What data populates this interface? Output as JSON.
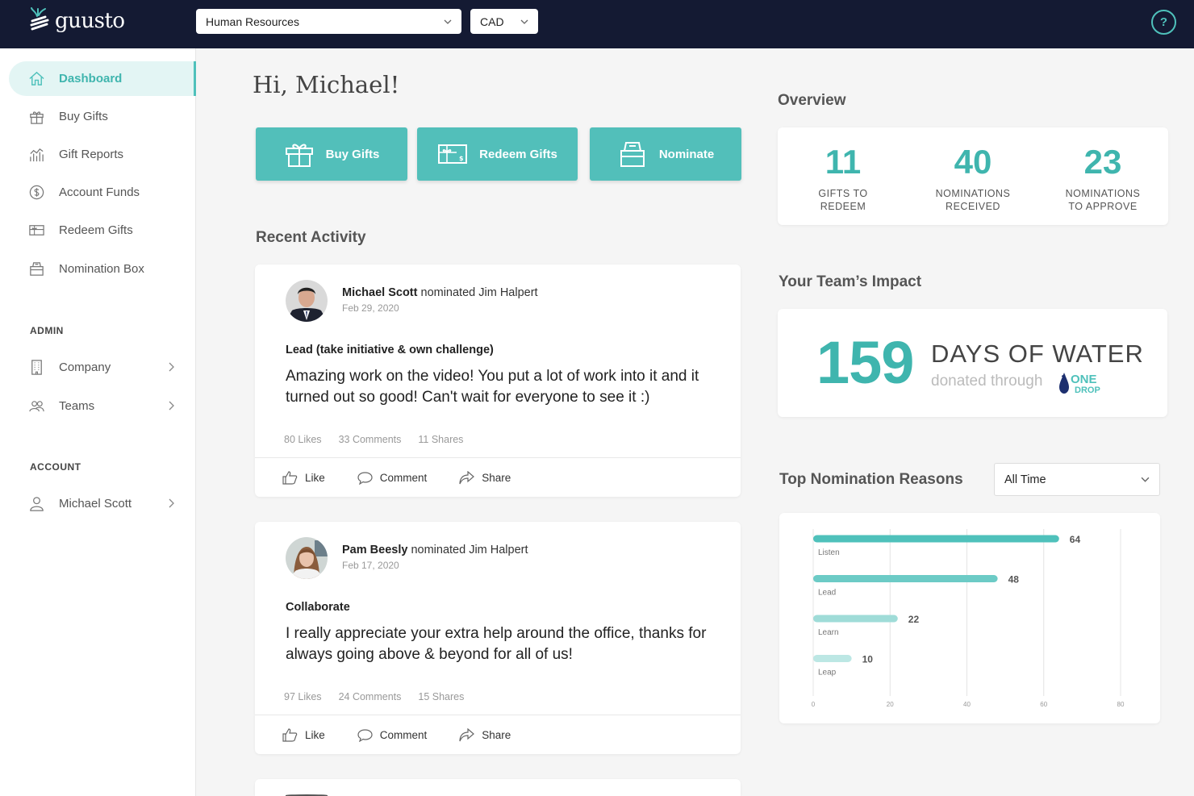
{
  "brand": {
    "name": "guusto",
    "accent": "#52bfba",
    "topbar": "#141a33"
  },
  "header": {
    "department": "Human Resources",
    "currency": "CAD",
    "help": "?"
  },
  "sidebar": {
    "items": [
      {
        "label": "Dashboard",
        "icon": "home-icon"
      },
      {
        "label": "Buy Gifts",
        "icon": "gift-icon"
      },
      {
        "label": "Gift Reports",
        "icon": "chart-icon"
      },
      {
        "label": "Account Funds",
        "icon": "dollar-icon"
      },
      {
        "label": "Redeem Gifts",
        "icon": "giftcard-icon"
      },
      {
        "label": "Nomination Box",
        "icon": "box-icon"
      }
    ],
    "admin_label": "ADMIN",
    "admin_items": [
      {
        "label": "Company",
        "icon": "building-icon"
      },
      {
        "label": "Teams",
        "icon": "people-icon"
      }
    ],
    "account_label": "ACCOUNT",
    "account_items": [
      {
        "label": "Michael Scott",
        "icon": "user-icon"
      }
    ]
  },
  "main": {
    "greeting": "Hi, Michael!",
    "actions": [
      {
        "label": "Buy Gifts",
        "icon": "gift-icon"
      },
      {
        "label": "Redeem Gifts",
        "icon": "giftcard-icon"
      },
      {
        "label": "Nominate",
        "icon": "box-icon"
      }
    ],
    "recent_activity_title": "Recent Activity",
    "posts": [
      {
        "author": "Michael Scott",
        "verb": "nominated Jim Halpert",
        "date": "Feb 29, 2020",
        "reason": "Lead (take initiative & own challenge)",
        "message": "Amazing work on the video! You put a lot of work into it and it turned out so good! Can't wait for everyone to see it :)",
        "likes": "80 Likes",
        "comments": "33 Comments",
        "shares": "11 Shares"
      },
      {
        "author": "Pam Beesly",
        "verb": "nominated Jim Halpert",
        "date": "Feb 17, 2020",
        "reason": "Collaborate",
        "message": "I really appreciate your extra help around the office, thanks for always going above & beyond for all of us!",
        "likes": "97 Likes",
        "comments": "24 Comments",
        "shares": "15 Shares"
      }
    ],
    "post_actions": {
      "like": "Like",
      "comment": "Comment",
      "share": "Share"
    }
  },
  "overview": {
    "title": "Overview",
    "stats": [
      {
        "value": "11",
        "label_1": "GIFTS TO",
        "label_2": "REDEEM"
      },
      {
        "value": "40",
        "label_1": "NOMINATIONS",
        "label_2": "RECEIVED"
      },
      {
        "value": "23",
        "label_1": "NOMINATIONS",
        "label_2": "TO APPROVE"
      }
    ]
  },
  "impact": {
    "title": "Your Team’s Impact",
    "value": "159",
    "headline": "DAYS OF WATER",
    "sub": "donated through",
    "partner_line1": "ONE",
    "partner_line2": "DROP"
  },
  "nominations": {
    "title": "Top Nomination Reasons",
    "filter": "All Time"
  },
  "chart_data": {
    "type": "bar",
    "orientation": "horizontal",
    "categories": [
      "Listen",
      "Lead",
      "Learn",
      "Leap"
    ],
    "values": [
      64,
      48,
      22,
      10
    ],
    "xlim": [
      0,
      80
    ],
    "xticks": [
      0,
      20,
      40,
      60,
      80
    ],
    "grid": true,
    "colors": [
      "#4fc1bb",
      "#6ccbc6",
      "#9fdcd8",
      "#bce7e4"
    ]
  }
}
